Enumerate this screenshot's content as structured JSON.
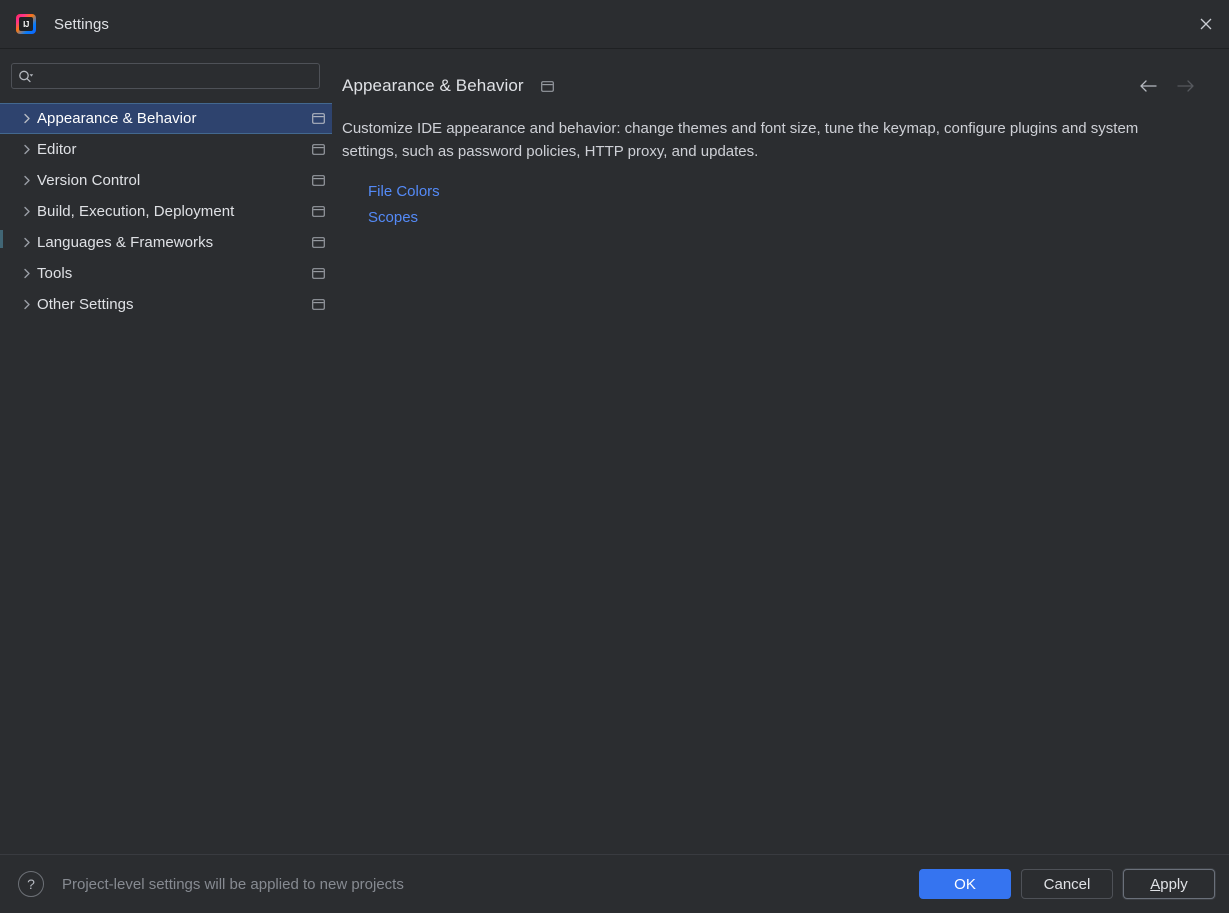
{
  "window": {
    "title": "Settings",
    "logo_text": "IJ",
    "logo_icon": "intellij-idea-logo",
    "close_icon": "close-icon"
  },
  "search": {
    "value": "",
    "placeholder": "",
    "icon": "search-icon",
    "dropdown_icon": "chevron-down-icon"
  },
  "sidebar": {
    "items": [
      {
        "label": "Appearance & Behavior",
        "selected": true,
        "expand_icon": "chevron-right-icon",
        "badge_icon": "project-level-settings-icon"
      },
      {
        "label": "Editor",
        "selected": false,
        "expand_icon": "chevron-right-icon",
        "badge_icon": "project-level-settings-icon"
      },
      {
        "label": "Version Control",
        "selected": false,
        "expand_icon": "chevron-right-icon",
        "badge_icon": "project-level-settings-icon"
      },
      {
        "label": "Build, Execution, Deployment",
        "selected": false,
        "expand_icon": "chevron-right-icon",
        "badge_icon": "project-level-settings-icon"
      },
      {
        "label": "Languages & Frameworks",
        "selected": false,
        "expand_icon": "chevron-right-icon",
        "badge_icon": "project-level-settings-icon"
      },
      {
        "label": "Tools",
        "selected": false,
        "expand_icon": "chevron-right-icon",
        "badge_icon": "project-level-settings-icon"
      },
      {
        "label": "Other Settings",
        "selected": false,
        "expand_icon": "chevron-right-icon",
        "badge_icon": "project-level-settings-icon"
      }
    ]
  },
  "content": {
    "title": "Appearance & Behavior",
    "badge_icon": "project-level-settings-icon",
    "nav": {
      "back_icon": "arrow-left-icon",
      "forward_icon": "arrow-right-icon"
    },
    "description": "Customize IDE appearance and behavior: change themes and font size, tune the keymap, configure plugins and system settings, such as password policies, HTTP proxy, and updates.",
    "links": [
      {
        "label": "File Colors"
      },
      {
        "label": "Scopes"
      }
    ]
  },
  "footer": {
    "help_icon": "help-question-icon",
    "help_label": "?",
    "status": "Project-level settings will be applied to new projects",
    "buttons": {
      "ok": "OK",
      "cancel": "Cancel",
      "apply_mnemonic": "A",
      "apply_rest": "pply"
    }
  },
  "colors": {
    "background": "#2b2d30",
    "selection": "#2e436e",
    "selection_border": "#43688f",
    "accent": "#3574f0",
    "link": "#548af7",
    "text": "#dfe1e5",
    "muted_text": "#868a91",
    "border": "#4e5157"
  }
}
